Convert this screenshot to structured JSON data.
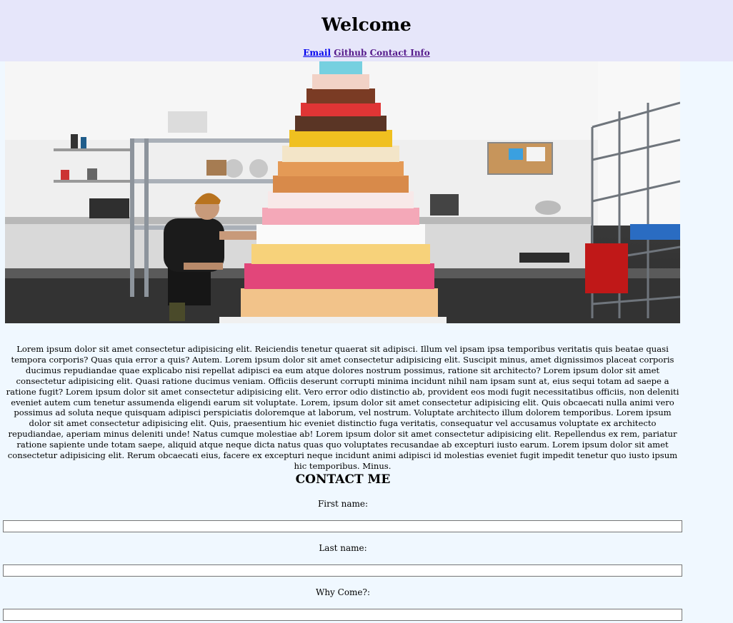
{
  "header": {
    "title": "Welcome",
    "links": [
      {
        "label": "Email"
      },
      {
        "label": "Github"
      },
      {
        "label": "Contact Info"
      }
    ]
  },
  "hero": {
    "image": "kitchen-tiered-cake-photo"
  },
  "intro_text": "Lorem ipsum dolor sit amet consectetur adipisicing elit. Reiciendis tenetur quaerat sit adipisci. Illum vel ipsam ipsa temporibus veritatis quis beatae quasi tempora corporis? Quas quia error a quis? Autem. Lorem ipsum dolor sit amet consectetur adipisicing elit. Suscipit minus, amet dignissimos placeat corporis ducimus repudiandae quae explicabo nisi repellat adipisci ea eum atque dolores nostrum possimus, ratione sit architecto? Lorem ipsum dolor sit amet consectetur adipisicing elit. Quasi ratione ducimus veniam. Officiis deserunt corrupti minima incidunt nihil nam ipsam sunt at, eius sequi totam ad saepe a ratione fugit? Lorem ipsum dolor sit amet consectetur adipisicing elit. Vero error odio distinctio ab, provident eos modi fugit necessitatibus officiis, non deleniti eveniet autem cum tenetur assumenda eligendi earum sit voluptate. Lorem, ipsum dolor sit amet consectetur adipisicing elit. Quis obcaecati nulla animi vero possimus ad soluta neque quisquam adipisci perspiciatis doloremque at laborum, vel nostrum. Voluptate architecto illum dolorem temporibus. Lorem ipsum dolor sit amet consectetur adipisicing elit. Quis, praesentium hic eveniet distinctio fuga veritatis, consequatur vel accusamus voluptate ex architecto repudiandae, aperiam minus deleniti unde! Natus cumque molestiae ab! Lorem ipsum dolor sit amet consectetur adipisicing elit. Repellendus ex rem, pariatur ratione sapiente unde totam saepe, aliquid atque neque dicta natus quas quo voluptates recusandae ab excepturi iusto earum. Lorem ipsum dolor sit amet consectetur adipisicing elit. Rerum obcaecati eius, facere ex excepturi neque incidunt animi adipisci id molestias eveniet fugit impedit tenetur quo iusto ipsum hic temporibus. Minus.",
  "contact": {
    "title": "CONTACT ME",
    "fields": [
      {
        "label": "First name:",
        "value": ""
      },
      {
        "label": "Last name:",
        "value": ""
      },
      {
        "label": "Why Come?:",
        "value": ""
      }
    ]
  },
  "colors": {
    "header_bg": "#e6e6fa",
    "page_bg": "#f0f8ff",
    "link": "#0000ee",
    "visited_link": "#551a8b"
  }
}
